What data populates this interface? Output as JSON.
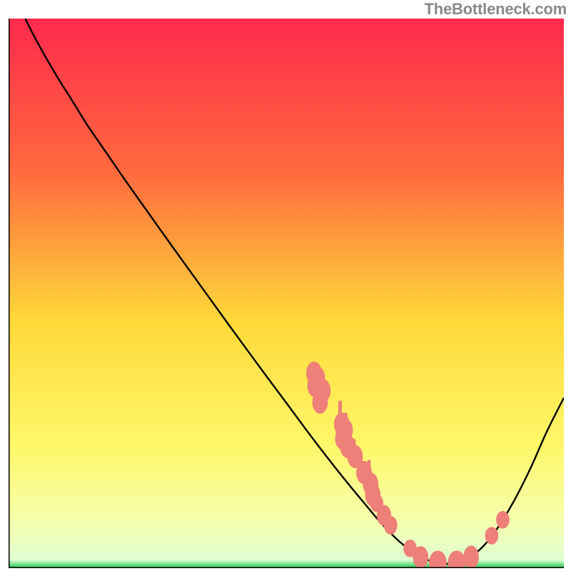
{
  "watermark": "TheBottleneck.com",
  "chart_data": {
    "type": "line",
    "title": "",
    "xlabel": "",
    "ylabel": "",
    "xlim": [
      0,
      100
    ],
    "ylim": [
      0,
      100
    ],
    "gradient_stops": [
      {
        "offset": 0.0,
        "color": "#ff2a4d"
      },
      {
        "offset": 0.28,
        "color": "#ff6a3e"
      },
      {
        "offset": 0.55,
        "color": "#ffd93a"
      },
      {
        "offset": 0.78,
        "color": "#fff86a"
      },
      {
        "offset": 0.92,
        "color": "#f5ffb0"
      },
      {
        "offset": 0.985,
        "color": "#dfffd2"
      },
      {
        "offset": 1.0,
        "color": "#17c24c"
      }
    ],
    "curve": [
      {
        "x": 3.0,
        "y": 100.0
      },
      {
        "x": 4.5,
        "y": 97.0
      },
      {
        "x": 6.5,
        "y": 93.3
      },
      {
        "x": 9.0,
        "y": 89.0
      },
      {
        "x": 11.5,
        "y": 85.0
      },
      {
        "x": 14.0,
        "y": 80.9
      },
      {
        "x": 17.8,
        "y": 75.3
      },
      {
        "x": 21.0,
        "y": 70.6
      },
      {
        "x": 25.0,
        "y": 64.9
      },
      {
        "x": 30.0,
        "y": 57.8
      },
      {
        "x": 35.0,
        "y": 50.8
      },
      {
        "x": 40.0,
        "y": 43.8
      },
      {
        "x": 45.0,
        "y": 36.9
      },
      {
        "x": 50.0,
        "y": 30.1
      },
      {
        "x": 55.0,
        "y": 23.3
      },
      {
        "x": 60.0,
        "y": 16.8
      },
      {
        "x": 64.0,
        "y": 11.9
      },
      {
        "x": 67.0,
        "y": 8.3
      },
      {
        "x": 70.0,
        "y": 5.2
      },
      {
        "x": 73.0,
        "y": 2.8
      },
      {
        "x": 76.0,
        "y": 1.3
      },
      {
        "x": 78.5,
        "y": 0.8
      },
      {
        "x": 81.0,
        "y": 1.0
      },
      {
        "x": 83.0,
        "y": 1.9
      },
      {
        "x": 85.5,
        "y": 4.0
      },
      {
        "x": 88.0,
        "y": 7.2
      },
      {
        "x": 91.0,
        "y": 12.2
      },
      {
        "x": 94.0,
        "y": 18.2
      },
      {
        "x": 97.0,
        "y": 25.0
      },
      {
        "x": 100.0,
        "y": 31.0
      }
    ],
    "markers": [
      {
        "x": 55.0,
        "y": 35.5,
        "rx": 1.4,
        "ry": 2.1
      },
      {
        "x": 55.6,
        "y": 34.6,
        "rx": 1.4,
        "ry": 2.1
      },
      {
        "x": 55.2,
        "y": 33.2,
        "rx": 1.4,
        "ry": 2.1
      },
      {
        "x": 56.6,
        "y": 32.3,
        "rx": 1.4,
        "ry": 2.1
      },
      {
        "x": 56.1,
        "y": 30.2,
        "rx": 1.4,
        "ry": 2.1
      },
      {
        "x": 60.0,
        "y": 26.2,
        "rx": 1.4,
        "ry": 2.1
      },
      {
        "x": 60.6,
        "y": 25.1,
        "rx": 1.4,
        "ry": 2.1
      },
      {
        "x": 60.2,
        "y": 23.6,
        "rx": 1.4,
        "ry": 2.1
      },
      {
        "x": 61.1,
        "y": 22.1,
        "rx": 1.4,
        "ry": 2.1
      },
      {
        "x": 62.4,
        "y": 20.3,
        "rx": 1.4,
        "ry": 2.1
      },
      {
        "x": 64.0,
        "y": 17.4,
        "rx": 1.4,
        "ry": 2.1
      },
      {
        "x": 65.2,
        "y": 15.3,
        "rx": 1.4,
        "ry": 2.1
      },
      {
        "x": 65.6,
        "y": 13.3,
        "rx": 1.4,
        "ry": 2.1
      },
      {
        "x": 66.3,
        "y": 11.8,
        "rx": 1.2,
        "ry": 1.6
      },
      {
        "x": 67.6,
        "y": 9.6,
        "rx": 1.3,
        "ry": 1.9
      },
      {
        "x": 68.8,
        "y": 7.8,
        "rx": 1.2,
        "ry": 1.7
      },
      {
        "x": 72.3,
        "y": 3.6,
        "rx": 1.2,
        "ry": 1.6
      },
      {
        "x": 74.2,
        "y": 2.0,
        "rx": 1.4,
        "ry": 2.0
      },
      {
        "x": 77.3,
        "y": 1.0,
        "rx": 1.6,
        "ry": 2.2
      },
      {
        "x": 80.7,
        "y": 1.0,
        "rx": 1.6,
        "ry": 2.2
      },
      {
        "x": 83.3,
        "y": 2.0,
        "rx": 1.4,
        "ry": 2.1
      },
      {
        "x": 87.0,
        "y": 5.9,
        "rx": 1.2,
        "ry": 1.6
      },
      {
        "x": 89.0,
        "y": 8.8,
        "rx": 1.2,
        "ry": 1.6
      }
    ],
    "under_drips": [
      {
        "x": 59.7,
        "y_top": 30.2,
        "y_bot": 27.8
      },
      {
        "x": 60.7,
        "y_top": 28.0,
        "y_bot": 25.1
      },
      {
        "x": 62.2,
        "y_top": 23.2,
        "y_bot": 21.1
      },
      {
        "x": 64.9,
        "y_top": 19.4,
        "y_bot": 16.2
      }
    ],
    "marker_color": "#ee7f79",
    "curve_color": "#000000",
    "axis_color": "#000000"
  }
}
